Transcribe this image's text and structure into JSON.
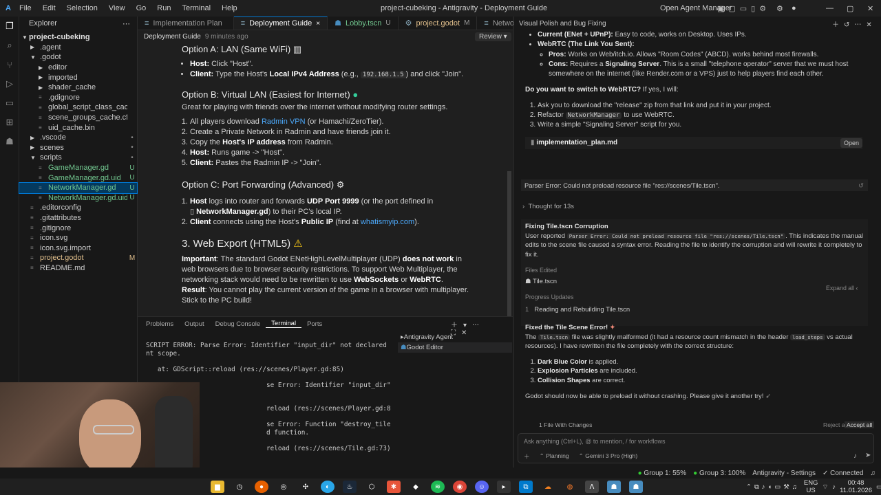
{
  "window_title": "project-cubeking - Antigravity - Deployment Guide",
  "menu": [
    "File",
    "Edit",
    "Selection",
    "View",
    "Go",
    "Run",
    "Terminal",
    "Help"
  ],
  "open_agent_manager": "Open Agent Manager",
  "explorer": {
    "title": "Explorer",
    "project": "project-cubeking",
    "items": [
      {
        "label": ".agent",
        "depth": 1,
        "kind": "folder",
        "status": ""
      },
      {
        "label": ".godot",
        "depth": 1,
        "kind": "folder-open",
        "status": ""
      },
      {
        "label": "editor",
        "depth": 2,
        "kind": "folder",
        "status": ""
      },
      {
        "label": "imported",
        "depth": 2,
        "kind": "folder",
        "status": ""
      },
      {
        "label": "shader_cache",
        "depth": 2,
        "kind": "folder",
        "status": ""
      },
      {
        "label": ".gdignore",
        "depth": 2,
        "kind": "file",
        "status": ""
      },
      {
        "label": "global_script_class_cache.cfg",
        "depth": 2,
        "kind": "file",
        "status": ""
      },
      {
        "label": "scene_groups_cache.cfg",
        "depth": 2,
        "kind": "file",
        "status": ""
      },
      {
        "label": "uid_cache.bin",
        "depth": 2,
        "kind": "file",
        "status": ""
      },
      {
        "label": ".vscode",
        "depth": 1,
        "kind": "folder",
        "status": "•"
      },
      {
        "label": "scenes",
        "depth": 1,
        "kind": "folder",
        "status": "•"
      },
      {
        "label": "scripts",
        "depth": 1,
        "kind": "folder-open",
        "status": "•"
      },
      {
        "label": "GameManager.gd",
        "depth": 2,
        "kind": "file",
        "status": "U"
      },
      {
        "label": "GameManager.gd.uid",
        "depth": 2,
        "kind": "file",
        "status": "U"
      },
      {
        "label": "NetworkManager.gd",
        "depth": 2,
        "kind": "file",
        "status": "U"
      },
      {
        "label": "NetworkManager.gd.uid",
        "depth": 2,
        "kind": "file",
        "status": "U"
      },
      {
        "label": ".editorconfig",
        "depth": 1,
        "kind": "file",
        "status": ""
      },
      {
        "label": ".gitattributes",
        "depth": 1,
        "kind": "file",
        "status": ""
      },
      {
        "label": ".gitignore",
        "depth": 1,
        "kind": "file",
        "status": ""
      },
      {
        "label": "icon.svg",
        "depth": 1,
        "kind": "file",
        "status": ""
      },
      {
        "label": "icon.svg.import",
        "depth": 1,
        "kind": "file",
        "status": ""
      },
      {
        "label": "project.godot",
        "depth": 1,
        "kind": "file",
        "status": "M"
      },
      {
        "label": "README.md",
        "depth": 1,
        "kind": "file",
        "status": ""
      }
    ]
  },
  "tabs": [
    {
      "label": "Implementation Plan",
      "badge": ""
    },
    {
      "label": "Deployment Guide",
      "badge": "×"
    },
    {
      "label": "Lobby.tscn",
      "badge": "U"
    },
    {
      "label": "project.godot",
      "badge": "M"
    },
    {
      "label": "Netwo",
      "badge": ""
    }
  ],
  "breadcrumb": {
    "title": "Deployment Guide",
    "time": "9 minutes ago",
    "review": "Review"
  },
  "doc": {
    "optA": "Option A: LAN (Same WiFi)",
    "a1b": "Host:",
    "a1": " Click \"Host\".",
    "a2b": "Client:",
    "a2a": " Type the Host's ",
    "a2c": "Local IPv4 Address",
    "a2d": " (e.g., ",
    "a2code": "192.168.1.5",
    "a2e": ") and click \"Join\".",
    "optB": "Option B: Virtual LAN (Easiest for Internet)",
    "bintro": "Great for playing with friends over the internet without modifying router settings.",
    "b1a": "All players download ",
    "b1link": "Radmin VPN",
    "b1b": " (or Hamachi/ZeroTier).",
    "b2": "Create a Private Network in Radmin and have friends join it.",
    "b3a": "Copy the ",
    "b3b": "Host's IP address",
    "b3c": " from Radmin.",
    "b4b": "Host:",
    "b4": " Runs game -> \"Host\".",
    "b5b": "Client:",
    "b5": " Pastes the Radmin IP -> \"Join\".",
    "optC": "Option C: Port Forwarding (Advanced)",
    "c1b": "Host",
    "c1a": " logs into router and forwards ",
    "c1c": "UDP Port 9999",
    "c1d": " (or the port defined in",
    "c1file": "NetworkManager.gd",
    "c1e": ") to their PC's local IP.",
    "c2b": "Client",
    "c2a": " connects using the Host's ",
    "c2c": "Public IP",
    "c2d": " (find at ",
    "c2link": "whatismyip.com",
    "c2e": ").",
    "sec3": "3. Web Export (HTML5)",
    "impb": "Important",
    "imp1": ": The standard Godot ENetHighLevelMultiplayer (UDP) ",
    "imp2": "does not work",
    "imp3": " in web browsers due to browser security restrictions. To support Web Multiplayer, the networking stack would need to be rewritten to use ",
    "imp4": "WebSockets",
    "imp5": " or ",
    "imp6": "WebRTC",
    "imp7": ".",
    "resb": "Result",
    "res": ": You cannot play the current version of the game in a browser with multiplayer. Stick to the PC build!"
  },
  "panel_tabs": [
    "Problems",
    "Output",
    "Debug Console",
    "Terminal",
    "Ports"
  ],
  "terminal_lines": [
    "SCRIPT ERROR: Parse Error: Identifier \"input_dir\" not declared in the curre",
    "nt scope.",
    "",
    "   at: GDScript::reload (res://scenes/Player.gd:85)",
    "",
    "                               se Error: Identifier \"input_dir\" not declared in the curre",
    "",
    "",
    "                               reload (res://scenes/Player.gd:85)",
    "",
    "                               se Error: Function \"destroy_tile\" has the same name as a p",
    "                               d function.",
    "",
    "                               reload (res://scenes/Tile.gd:73)"
  ],
  "terminal_list": [
    "Antigravity Agent",
    "Godot Editor"
  ],
  "chat": {
    "title": "Visual Polish and Bug Fixing",
    "cur": "Current (ENet + UPnP):",
    "cur_t": " Easy to code, works on Desktop. Uses IPs.",
    "webrtc": "WebRTC (The Link You Sent):",
    "pros": "Pros:",
    "pros_t": " Works on Web/itch.io. Allows \"Room Codes\" (ABCD). works behind most firewalls.",
    "cons": "Cons:",
    "cons_t1": " Requires a ",
    "cons_b": "Signaling Server",
    "cons_t2": ". This is a small \"telephone operator\" server that we must host somewhere on the internet (like Render.com or a VPS) just to help players find each other.",
    "q": "Do you want to switch to WebRTC?",
    "q_t": " If yes, I will:",
    "s1": "Ask you to download the \"release\" zip from that link and put it in your project.",
    "s2a": "Refactor ",
    "s2code": "NetworkManager",
    "s2b": " to use WebRTC.",
    "s3": "Write a simple \"Signaling Server\" script for you.",
    "file": "implementation_plan.md",
    "open": "Open",
    "user_msg": "Parser Error: Could not preload resource file \"res://scenes/Tile.tscn\".",
    "thought": "Thought for 13s",
    "fix_title": "Fixing Tile.tscn Corruption",
    "fix_t1": "User reported ",
    "fix_code": "Parser Error: Could not preload resource file \"res://scenes/Tile.tscn\"",
    "fix_t2": ". This indicates the manual edits to the scene file caused a syntax error. Reading the file to identify the corruption and will rewrite it completely to fix it.",
    "files_edited": "Files Edited",
    "edited_file": "Tile.tscn",
    "progress": "Progress Updates",
    "expand": "Expand all",
    "prog_n": "1",
    "prog_t": "Reading and Rebuilding Tile.tscn",
    "fixed_title": "Fixed the Tile Scene Error!",
    "fixed_t1": "The ",
    "fixed_code1": "Tile.tscn",
    "fixed_t2": " file was slightly malformed (it had a resource count mismatch in the header ",
    "fixed_code2": "load_steps",
    "fixed_t3": " vs actual resources). I have rewritten the file completely with the correct structure:",
    "l1b": "Dark Blue Color",
    "l1": " is applied.",
    "l2b": "Explosion Particles",
    "l2": " are included.",
    "l3b": "Collision Shapes",
    "l3": " are correct.",
    "final": "Godot should now be able to preload it without crashing. Please give it another try!",
    "changes": "1 File With Changes",
    "reject": "Reject all",
    "accept": "Accept all",
    "input_ph": "Ask anything (Ctrl+L), @ to mention, / for workflows",
    "mode": "Planning",
    "model": "Gemini 3 Pro (High)"
  },
  "statusbar": {
    "g1": "Group 1: 55%",
    "g3": "Group 3: 100%",
    "settings": "Antigravity - Settings",
    "conn": "Connected"
  },
  "clock": {
    "lang1": "ENG",
    "lang2": "US",
    "time": "00:48",
    "date": "11.01.2026"
  }
}
